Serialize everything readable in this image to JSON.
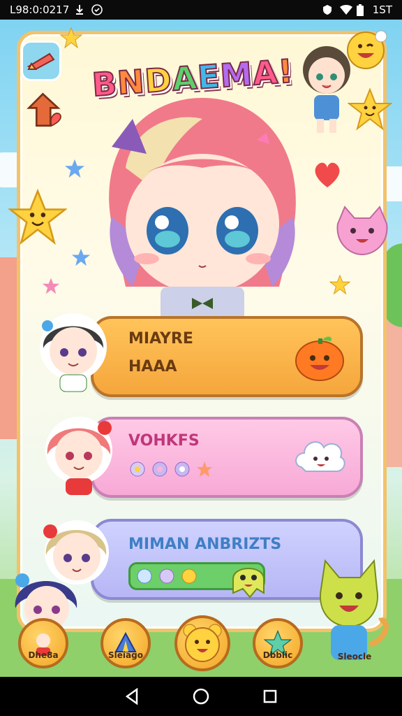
{
  "status_bar": {
    "time": "L98:0:0217",
    "right_text": "1ST"
  },
  "game": {
    "title": "BNDAEMA!",
    "title_letter_colors": [
      "#ff5a8a",
      "#ff8a3d",
      "#ffd23f",
      "#5bd16b",
      "#42b7e8",
      "#b36bf0",
      "#ff5a8a",
      "#ff8a3d"
    ]
  },
  "menu": [
    {
      "title": "MIAYRE",
      "subtitle": "HAAA",
      "accent": "#f5a63c",
      "mascot": "pumpkin-icon"
    },
    {
      "title": "VOHKFS",
      "subtitle": "",
      "accent": "#f7a9d6",
      "mascot": "cloud-icon"
    },
    {
      "title": "MIMAN ANBRIZTS",
      "subtitle": "",
      "accent": "#b7b6f5",
      "mascot": "ghost-icon"
    }
  ],
  "bottom_nav": [
    {
      "label": "Dhe8a",
      "icon": "avatar-icon"
    },
    {
      "label": "Sleiago",
      "icon": "tent-icon"
    },
    {
      "label": "",
      "icon": "bear-face-icon"
    },
    {
      "label": "Dbblic",
      "icon": "star-icon"
    },
    {
      "label": "Sleocle",
      "icon": "cat-icon"
    }
  ],
  "colors": {
    "panel_border": "#f2c26b",
    "primary_pink": "#ff5a8a",
    "card_orange": "#f5a63c",
    "card_pink": "#f7a9d6",
    "card_purple": "#b7b6f5"
  }
}
